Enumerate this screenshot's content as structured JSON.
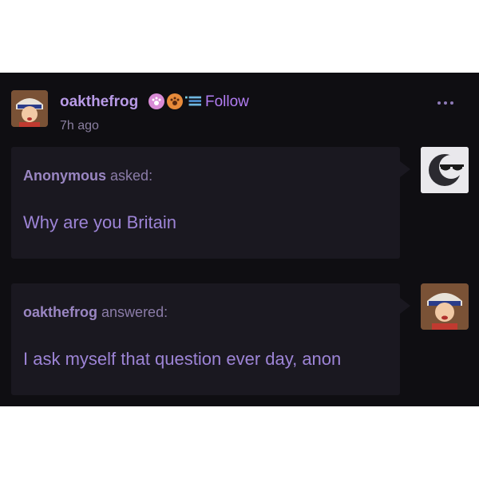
{
  "post": {
    "username": "oakthefrog",
    "follow_label": "Follow",
    "time": "7h ago",
    "question": {
      "asker": "Anonymous",
      "verb": "asked:",
      "text": "Why are you Britain"
    },
    "answer": {
      "author": "oakthefrog",
      "verb": "answered:",
      "text": "I ask myself that question ever day, anon"
    }
  },
  "colors": {
    "background": "#0f0e12",
    "bubble": "#1a1820",
    "username": "#b89ae6",
    "follow": "#b27cf2",
    "message": "#9d84d6"
  },
  "icons": [
    "avatar",
    "badge-paw-pink",
    "badge-paw-orange",
    "badge-banner",
    "more-icon",
    "anon-sunglasses-avatar"
  ]
}
